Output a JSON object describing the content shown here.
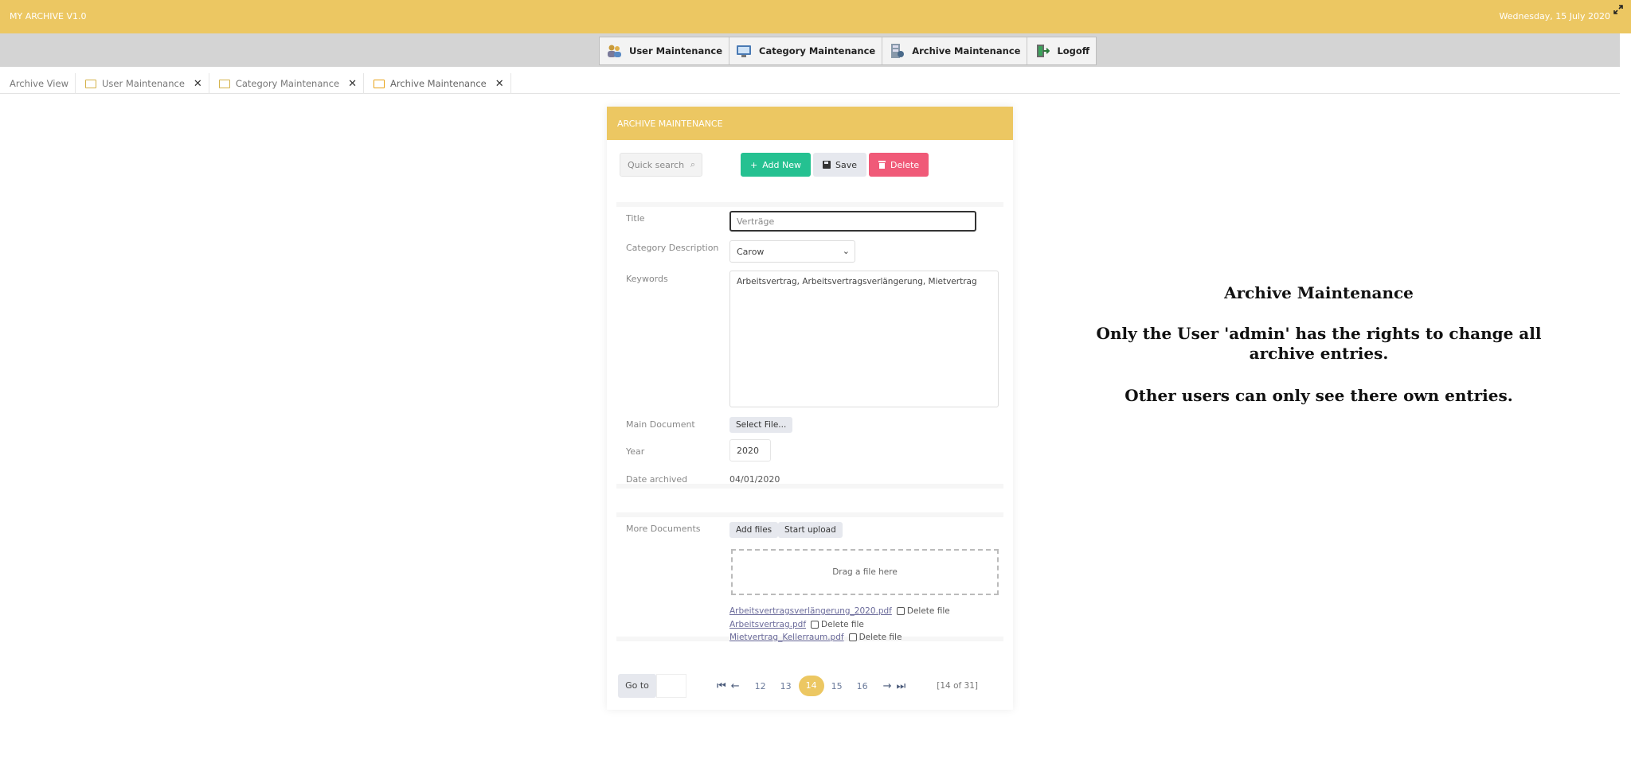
{
  "header": {
    "app_title": "MY ARCHIVE V1.0",
    "date": "Wednesday, 15 July 2020"
  },
  "menu": [
    {
      "label": "User Maintenance",
      "icon": "users-icon"
    },
    {
      "label": "Category Maintenance",
      "icon": "monitor-icon"
    },
    {
      "label": "Archive Maintenance",
      "icon": "archive-icon"
    },
    {
      "label": "Logoff",
      "icon": "logoff-icon"
    }
  ],
  "tabs": [
    {
      "label": "Archive View"
    },
    {
      "label": "User Maintenance"
    },
    {
      "label": "Category Maintenance"
    },
    {
      "label": "Archive Maintenance"
    }
  ],
  "panel": {
    "title": "ARCHIVE MAINTENANCE",
    "search_placeholder": "Quick search",
    "buttons": {
      "add": "Add New",
      "save": "Save",
      "delete": "Delete"
    }
  },
  "form": {
    "title_label": "Title",
    "title_value": "Verträge",
    "category_label": "Category Description",
    "category_value": "Carow",
    "keywords_label": "Keywords",
    "keywords_value": "Arbeitsvertrag, Arbeitsvertragsverlängerung, Mietvertrag",
    "main_doc_label": "Main Document",
    "select_file": "Select File...",
    "year_label": "Year",
    "year_value": "2020",
    "date_label": "Date archived",
    "date_value": "04/01/2020"
  },
  "docs": {
    "label": "More Documents",
    "add_files": "Add files",
    "start_upload": "Start upload",
    "dropzone": "Drag a file here",
    "delete_label": "Delete file",
    "files": [
      "Arbeitsvertragsverlängerung_2020.pdf",
      "Arbeitsvertrag.pdf",
      "Mietvertrag_Kellerraum.pdf"
    ]
  },
  "pager": {
    "goto": "Go to",
    "pages": [
      "12",
      "13",
      "14",
      "15",
      "16"
    ],
    "current": "14",
    "count": "[14 of 31]"
  },
  "info": {
    "heading": "Archive Maintenance",
    "line1": "Only the User 'admin' has the rights to change all archive entries.",
    "line2": "Other users can only see there own entries."
  },
  "colors": {
    "accent": "#ecc762",
    "add": "#25c191",
    "delete": "#f05a78"
  }
}
